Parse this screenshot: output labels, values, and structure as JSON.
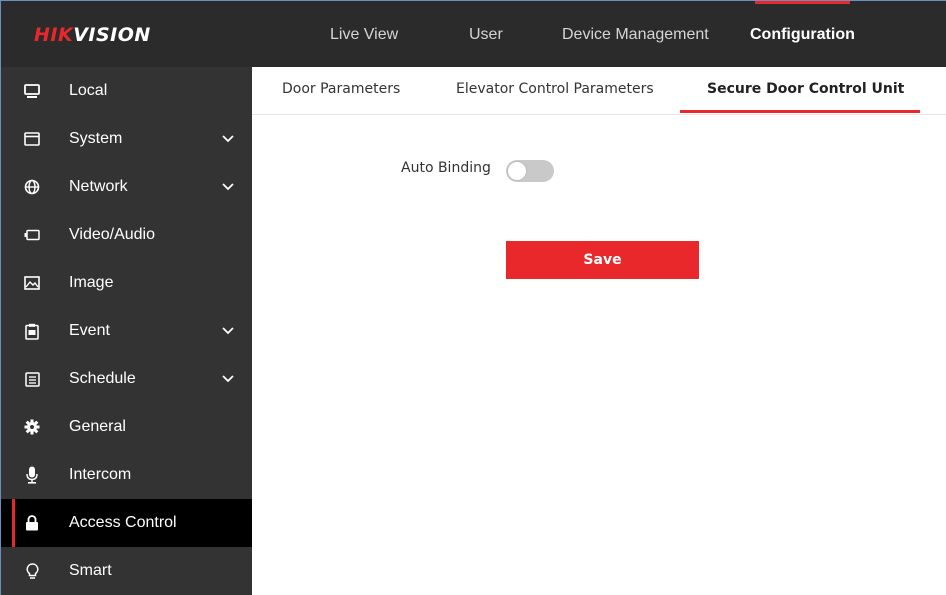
{
  "brand": {
    "logo_red": "HIK",
    "logo_white": "VISION"
  },
  "nav": {
    "items": [
      "Live View",
      "User",
      "Device Management",
      "Configuration"
    ],
    "active": "Configuration"
  },
  "sidebar": {
    "items": [
      {
        "label": "Local",
        "icon": "monitor-icon",
        "expandable": false
      },
      {
        "label": "System",
        "icon": "window-icon",
        "expandable": true
      },
      {
        "label": "Network",
        "icon": "globe-icon",
        "expandable": true
      },
      {
        "label": "Video/Audio",
        "icon": "video-icon",
        "expandable": false
      },
      {
        "label": "Image",
        "icon": "image-icon",
        "expandable": false
      },
      {
        "label": "Event",
        "icon": "clipboard-icon",
        "expandable": true
      },
      {
        "label": "Schedule",
        "icon": "calendar-icon",
        "expandable": true
      },
      {
        "label": "General",
        "icon": "gear-icon",
        "expandable": false
      },
      {
        "label": "Intercom",
        "icon": "microphone-icon",
        "expandable": false
      },
      {
        "label": "Access Control",
        "icon": "lock-icon",
        "expandable": false,
        "active": true
      },
      {
        "label": "Smart",
        "icon": "lightbulb-icon",
        "expandable": false
      }
    ]
  },
  "tabs": {
    "items": [
      "Door Parameters",
      "Elevator Control Parameters",
      "Secure Door Control Unit"
    ],
    "active": "Secure Door Control Unit"
  },
  "form": {
    "auto_binding_label": "Auto Binding",
    "auto_binding_on": false,
    "save_label": "Save"
  },
  "colors": {
    "accent": "#e8282b",
    "topbar": "#2b2b2b",
    "sidebar": "#333333"
  }
}
